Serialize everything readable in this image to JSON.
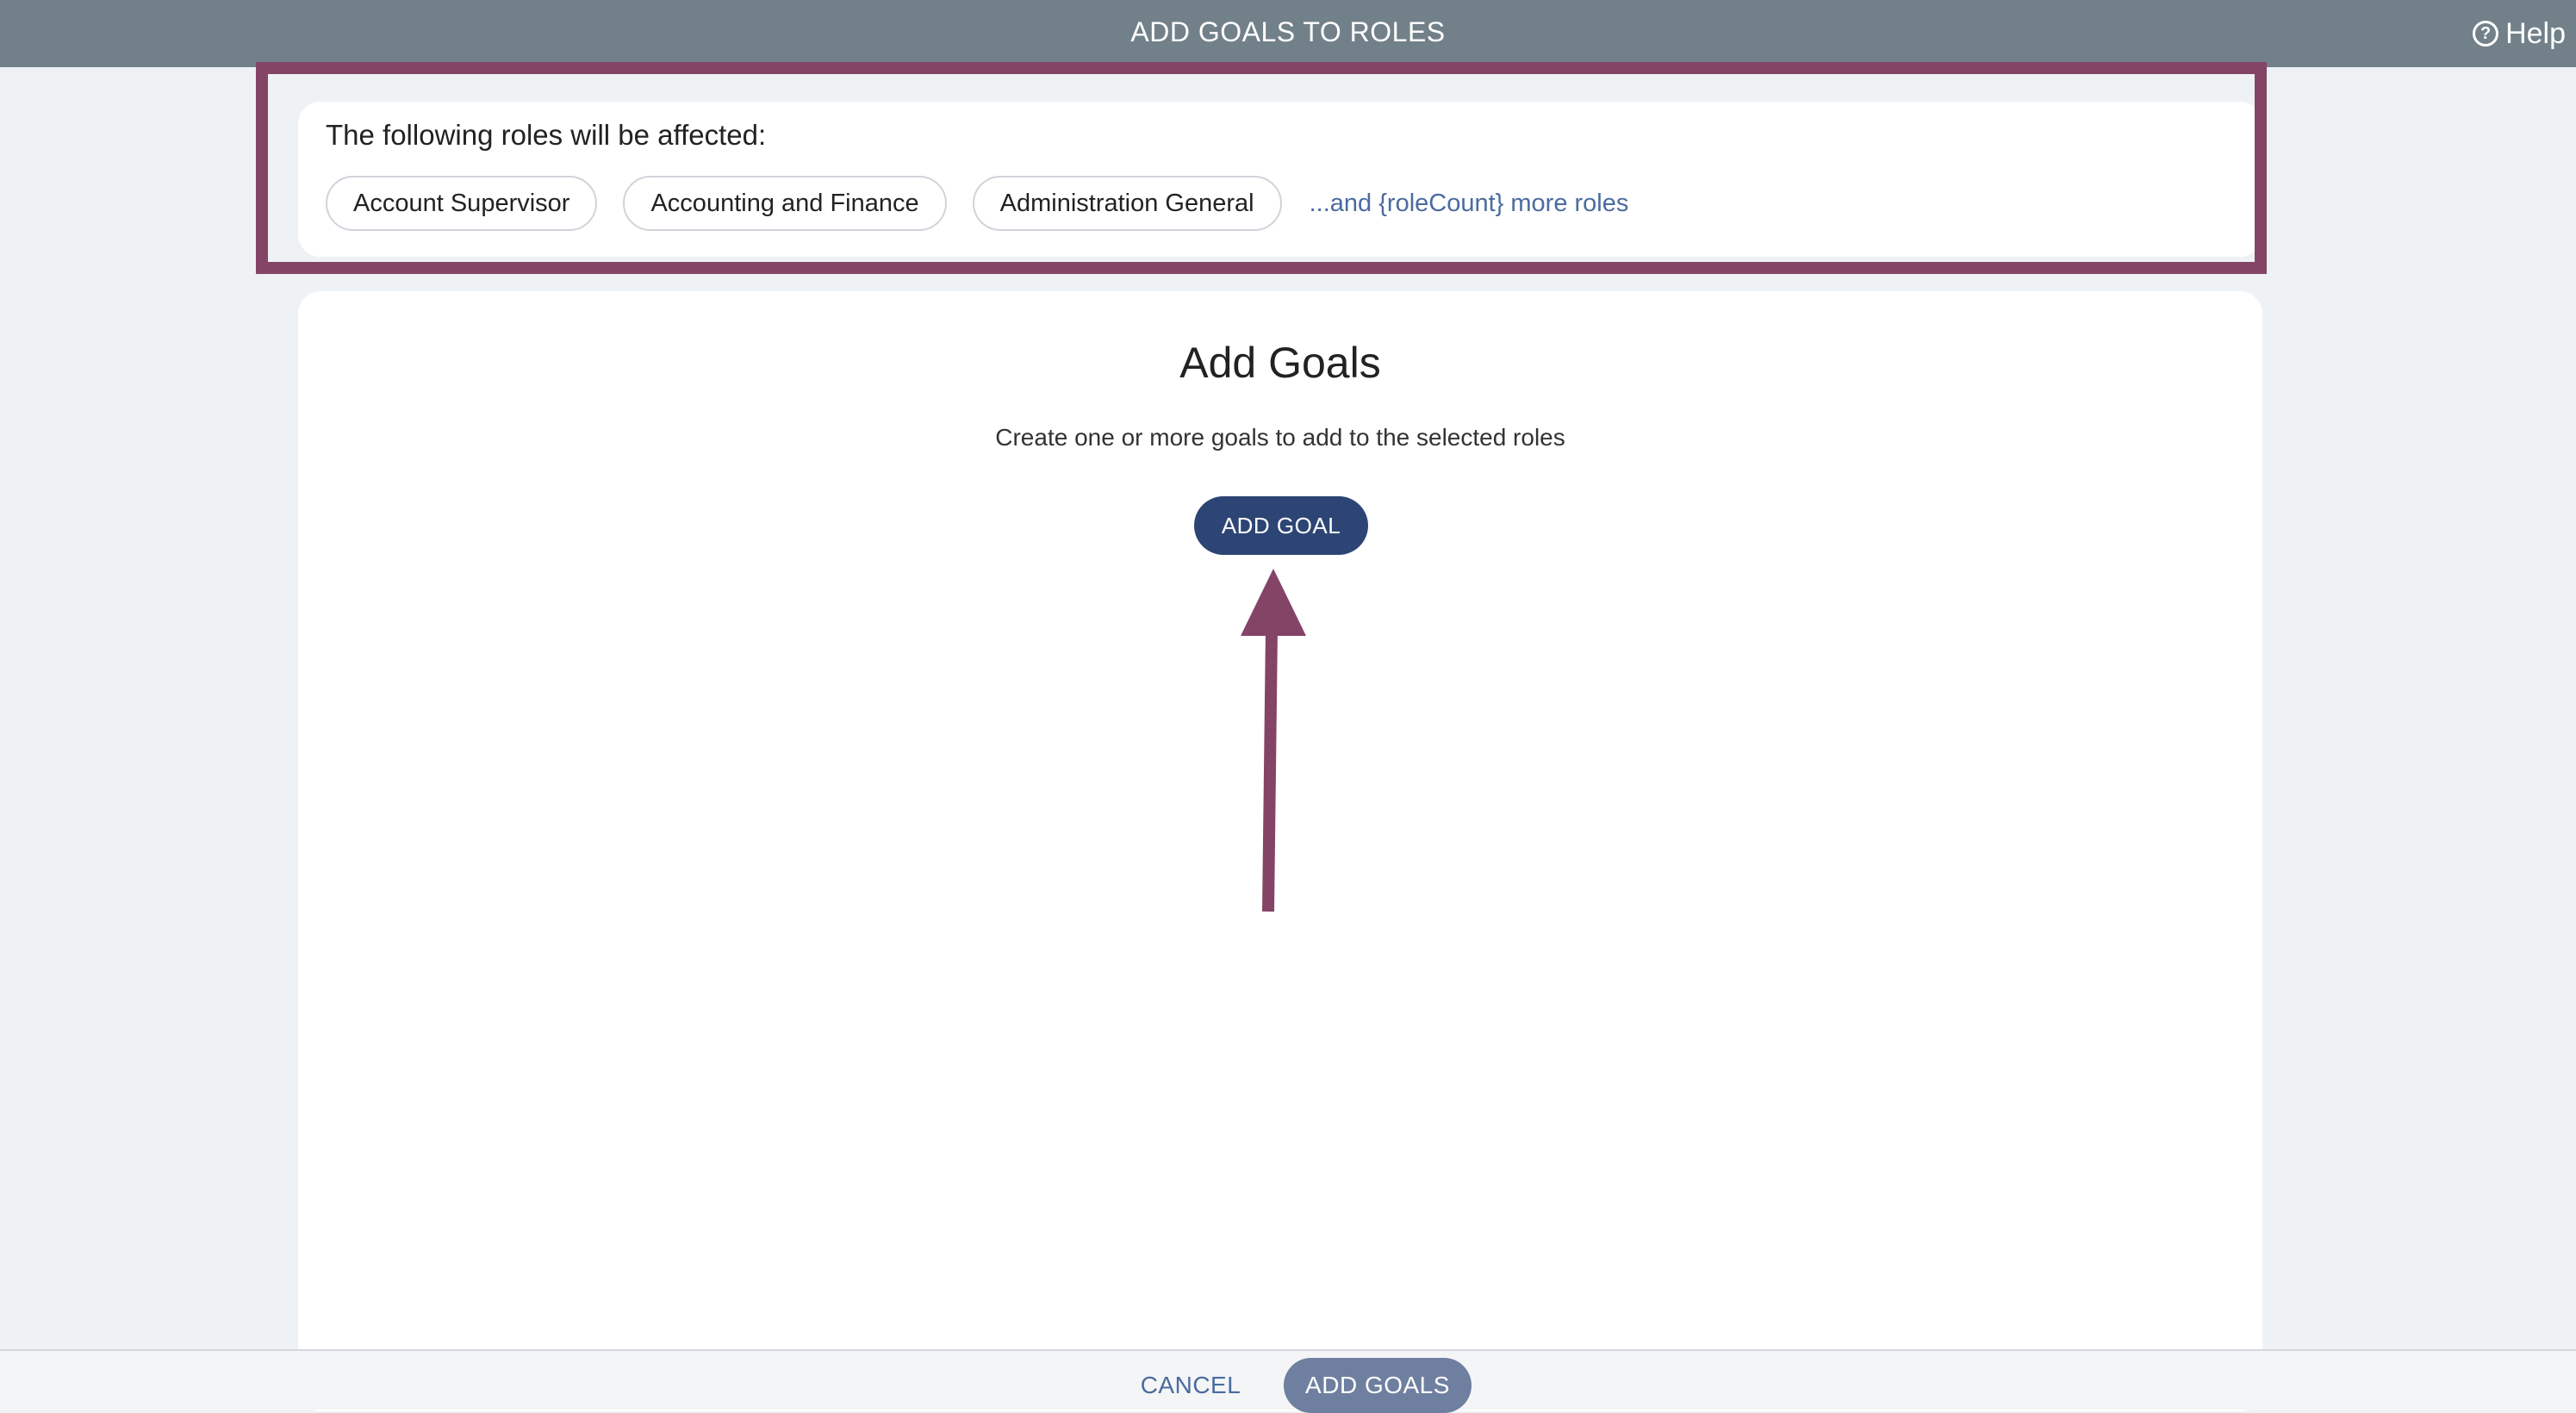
{
  "header": {
    "title": "ADD GOALS TO ROLES",
    "help_label": "Help",
    "help_icon": "question-circle-icon",
    "background": "#728089"
  },
  "roles_panel": {
    "heading": "The following roles will be affected:",
    "chips": [
      {
        "label": "Account Supervisor"
      },
      {
        "label": "Accounting and Finance"
      },
      {
        "label": "Administration General"
      }
    ],
    "more_link": "...and {roleCount} more roles"
  },
  "goals_panel": {
    "title": "Add Goals",
    "subtitle": "Create one or more goals to add to the selected roles",
    "add_goal_label": "ADD GOAL"
  },
  "annotation": {
    "color": "#844466",
    "shapes": [
      "highlight-box",
      "arrow-up"
    ]
  },
  "footer": {
    "cancel_label": "CANCEL",
    "submit_label": "ADD GOALS"
  },
  "colors": {
    "primary_button": "#2d4574",
    "disabled_button": "#6f7fa0",
    "link": "#4a6ba0",
    "page_background": "#eff2f5"
  }
}
